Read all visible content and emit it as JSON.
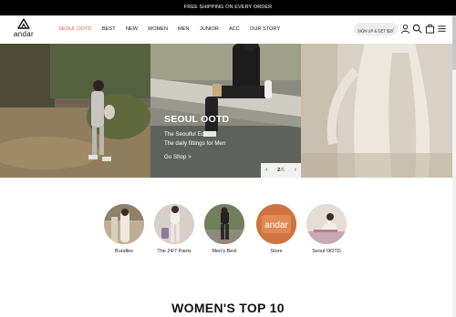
{
  "announcement": "FREE SHIPPING ON EVERY ORDER",
  "brand": {
    "name": "andar"
  },
  "nav": [
    {
      "label": "SEOUL OOTD",
      "active": true
    },
    {
      "label": "BEST",
      "active": false
    },
    {
      "label": "NEW",
      "active": false
    },
    {
      "label": "WOMEN",
      "active": false
    },
    {
      "label": "MEN",
      "active": false
    },
    {
      "label": "JUNIOR",
      "active": false
    },
    {
      "label": "ACC",
      "active": false
    },
    {
      "label": "OUR STORY",
      "active": false
    }
  ],
  "signup": {
    "label": "SIGN UP & GET $20",
    "badge": "!"
  },
  "header_icons": [
    "user-icon",
    "search-icon",
    "bag-icon",
    "menu-icon"
  ],
  "hero": {
    "title": "SEOUL OOTD",
    "lines": [
      "The Seoulful Edit",
      "The daily fittings for Men"
    ],
    "cta": "Go Shop >",
    "page": {
      "current": "2",
      "total": "6",
      "separator": "/"
    }
  },
  "categories": [
    {
      "label": "Bundles",
      "icon": "bundles-thumb"
    },
    {
      "label": "The 24/7 Pants",
      "icon": "pants-thumb"
    },
    {
      "label": "Men's Best",
      "icon": "mens-best-thumb"
    },
    {
      "label": "Store",
      "icon": "store-thumb",
      "text": "andar"
    },
    {
      "label": "Seoul OOTD",
      "icon": "seoul-ootd-thumb"
    }
  ],
  "section_title": "WOMEN'S TOP 10",
  "colors": {
    "accent": "#e65f2b",
    "topbar": "#000000"
  }
}
